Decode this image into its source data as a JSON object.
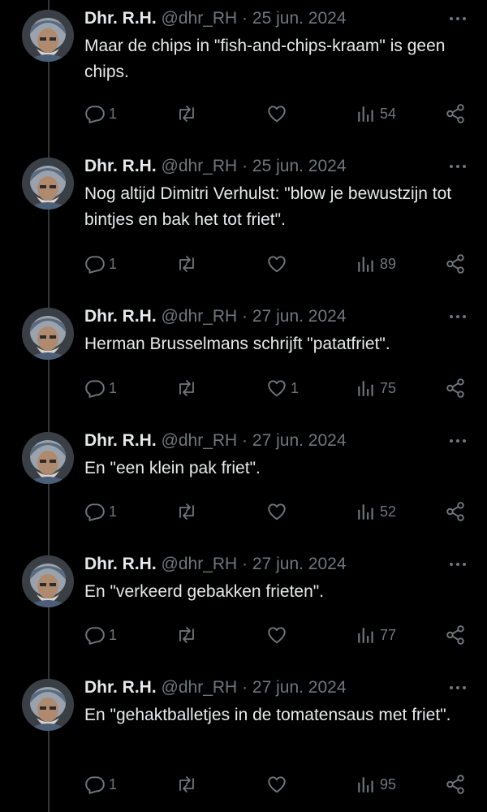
{
  "tweets": [
    {
      "name": "Dhr. R.H.",
      "handle": "@dhr_RH",
      "sep": "·",
      "date": "25 jun. 2024",
      "text": "Maar de chips in \"fish-and-chips-kraam\" is geen chips.",
      "replies": "1",
      "retweets": "",
      "likes": "",
      "views": "54"
    },
    {
      "name": "Dhr. R.H.",
      "handle": "@dhr_RH",
      "sep": "·",
      "date": "25 jun. 2024",
      "text": "Nog altijd Dimitri Verhulst: \"blow je bewustzijn tot bintjes en bak het tot friet\".",
      "replies": "1",
      "retweets": "",
      "likes": "",
      "views": "89"
    },
    {
      "name": "Dhr. R.H.",
      "handle": "@dhr_RH",
      "sep": "·",
      "date": "27 jun. 2024",
      "text": "Herman Brusselmans schrijft \"patatfriet\".",
      "replies": "1",
      "retweets": "",
      "likes": "1",
      "views": "75"
    },
    {
      "name": "Dhr. R.H.",
      "handle": "@dhr_RH",
      "sep": "·",
      "date": "27 jun. 2024",
      "text": "En \"een klein pak friet\".",
      "replies": "1",
      "retweets": "",
      "likes": "",
      "views": "52"
    },
    {
      "name": "Dhr. R.H.",
      "handle": "@dhr_RH",
      "sep": "·",
      "date": "27 jun. 2024",
      "text": "En \"verkeerd gebakken frieten\".",
      "replies": "1",
      "retweets": "",
      "likes": "",
      "views": "77"
    },
    {
      "name": "Dhr. R.H.",
      "handle": "@dhr_RH",
      "sep": "·",
      "date": "27 jun. 2024",
      "text": "En \"gehaktballetjes in de tomatensaus met friet\".",
      "replies": "1",
      "retweets": "",
      "likes": "",
      "views": "95"
    }
  ],
  "icons": {
    "reply": "reply-icon",
    "retweet": "retweet-icon",
    "like": "heart-icon",
    "views": "views-icon",
    "share": "share-icon",
    "more": "more-dots-icon"
  },
  "colors": {
    "background": "#000000",
    "text": "#e7e9ea",
    "muted": "#71767b",
    "thread_line": "#333639"
  }
}
